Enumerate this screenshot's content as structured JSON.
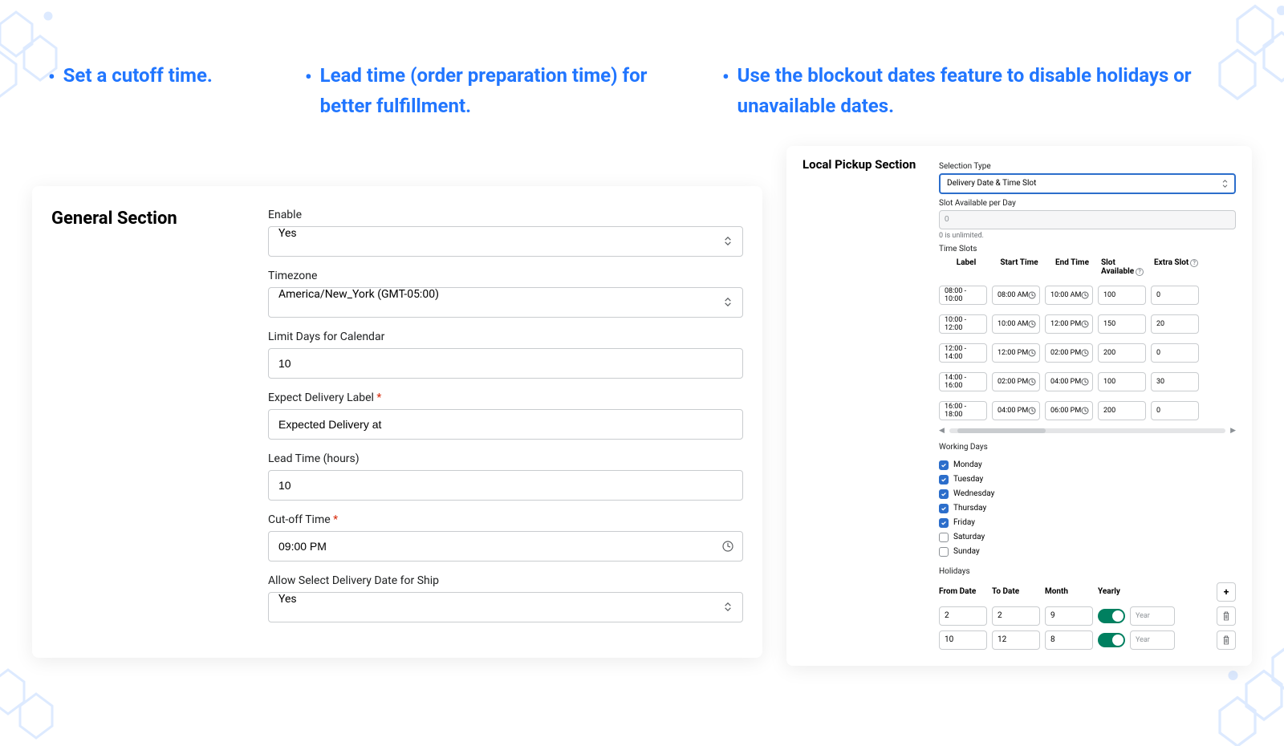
{
  "bullets": {
    "b1": "Set a cutoff time.",
    "b2": "Lead time (order preparation time) for better fulfillment.",
    "b3": "Use the blockout dates feature to disable holidays or unavailable dates."
  },
  "general": {
    "title": "General Section",
    "enable": {
      "label": "Enable",
      "value": "Yes"
    },
    "timezone": {
      "label": "Timezone",
      "value": "America/New_York (GMT-05:00)"
    },
    "limit_days": {
      "label": "Limit Days for Calendar",
      "value": "10"
    },
    "expect_label": {
      "label": "Expect Delivery Label",
      "value": "Expected Delivery at"
    },
    "lead_time": {
      "label": "Lead Time (hours)",
      "value": "10"
    },
    "cutoff": {
      "label": "Cut-off Time",
      "value": "09:00 PM"
    },
    "allow_ship": {
      "label": "Allow Select Delivery Date for Ship",
      "value": "Yes"
    }
  },
  "pickup": {
    "title": "Local Pickup Section",
    "selection_type": {
      "label": "Selection Type",
      "value": "Delivery Date & Time Slot"
    },
    "slot_per_day": {
      "label": "Slot Available per Day",
      "value": "0",
      "hint": "0 is unlimited."
    },
    "time_slots_label": "Time Slots",
    "headers": {
      "label": "Label",
      "start": "Start Time",
      "end": "End Time",
      "avail": "Slot Available",
      "extra": "Extra Slot"
    },
    "slots": [
      {
        "label": "08:00 - 10:00",
        "start": "08:00 AM",
        "end": "10:00 AM",
        "avail": "100",
        "extra": "0"
      },
      {
        "label": "10:00 - 12:00",
        "start": "10:00 AM",
        "end": "12:00 PM",
        "avail": "150",
        "extra": "20"
      },
      {
        "label": "12:00 - 14:00",
        "start": "12:00 PM",
        "end": "02:00 PM",
        "avail": "200",
        "extra": "0"
      },
      {
        "label": "14:00 - 16:00",
        "start": "02:00 PM",
        "end": "04:00 PM",
        "avail": "100",
        "extra": "30"
      },
      {
        "label": "16:00 - 18:00",
        "start": "04:00 PM",
        "end": "06:00 PM",
        "avail": "200",
        "extra": "0"
      }
    ],
    "working_days_label": "Working Days",
    "days": [
      {
        "name": "Monday",
        "on": true
      },
      {
        "name": "Tuesday",
        "on": true
      },
      {
        "name": "Wednesday",
        "on": true
      },
      {
        "name": "Thursday",
        "on": true
      },
      {
        "name": "Friday",
        "on": true
      },
      {
        "name": "Saturday",
        "on": false
      },
      {
        "name": "Sunday",
        "on": false
      }
    ],
    "holidays_label": "Holidays",
    "holidays_headers": {
      "from": "From Date",
      "to": "To Date",
      "month": "Month",
      "yearly": "Yearly"
    },
    "holidays": [
      {
        "from": "2",
        "to": "2",
        "month": "9",
        "yearly": true,
        "year": "Year"
      },
      {
        "from": "10",
        "to": "12",
        "month": "8",
        "yearly": true,
        "year": "Year"
      }
    ],
    "add_btn": "+"
  }
}
